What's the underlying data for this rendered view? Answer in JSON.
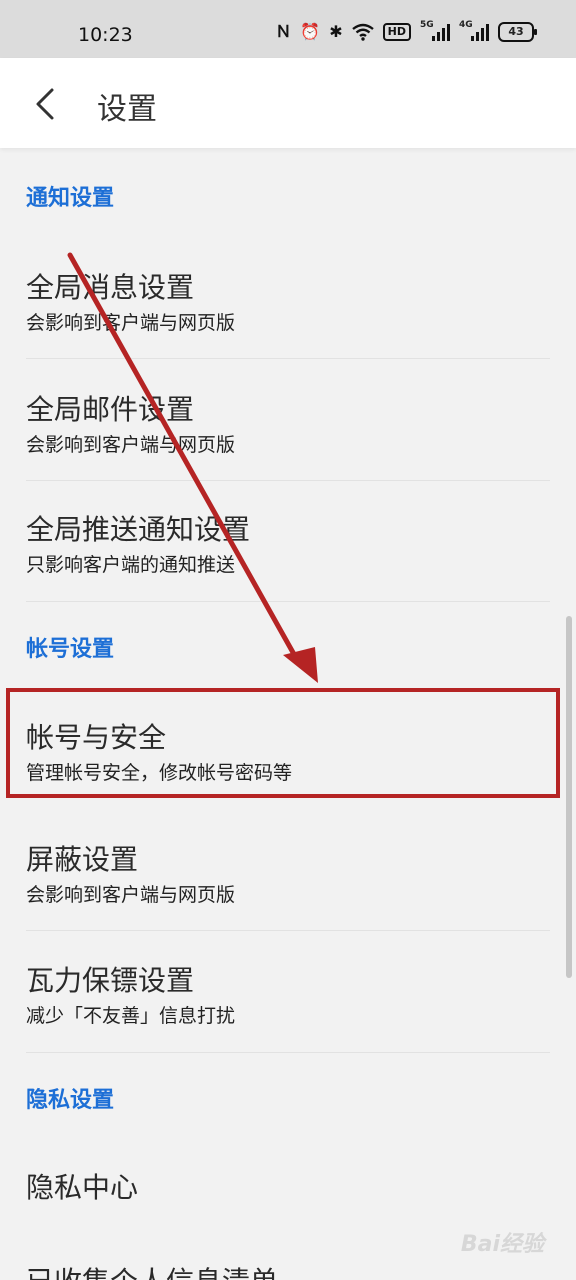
{
  "status_bar": {
    "time": "10:23",
    "hd_label": "HD",
    "net1_label": "5G",
    "net2_label": "4G",
    "battery": "43"
  },
  "header": {
    "title": "设置"
  },
  "sections": [
    {
      "title": "通知设置",
      "items": [
        {
          "title": "全局消息设置",
          "subtitle": "会影响到客户端与网页版"
        },
        {
          "title": "全局邮件设置",
          "subtitle": "会影响到客户端与网页版"
        },
        {
          "title": "全局推送通知设置",
          "subtitle": "只影响客户端的通知推送"
        }
      ]
    },
    {
      "title": "帐号设置",
      "items": [
        {
          "title": "帐号与安全",
          "subtitle": "管理帐号安全，修改帐号密码等"
        },
        {
          "title": "屏蔽设置",
          "subtitle": "会影响到客户端与网页版"
        },
        {
          "title": "瓦力保镖设置",
          "subtitle": "减少「不友善」信息打扰"
        }
      ]
    },
    {
      "title": "隐私设置",
      "items": [
        {
          "title": "隐私中心",
          "subtitle": ""
        },
        {
          "title": "已收集个人信息清单",
          "subtitle": ""
        }
      ]
    }
  ],
  "watermark": "Bai经验",
  "colors": {
    "accent": "#1d6fd6",
    "annotation": "#b52424"
  }
}
